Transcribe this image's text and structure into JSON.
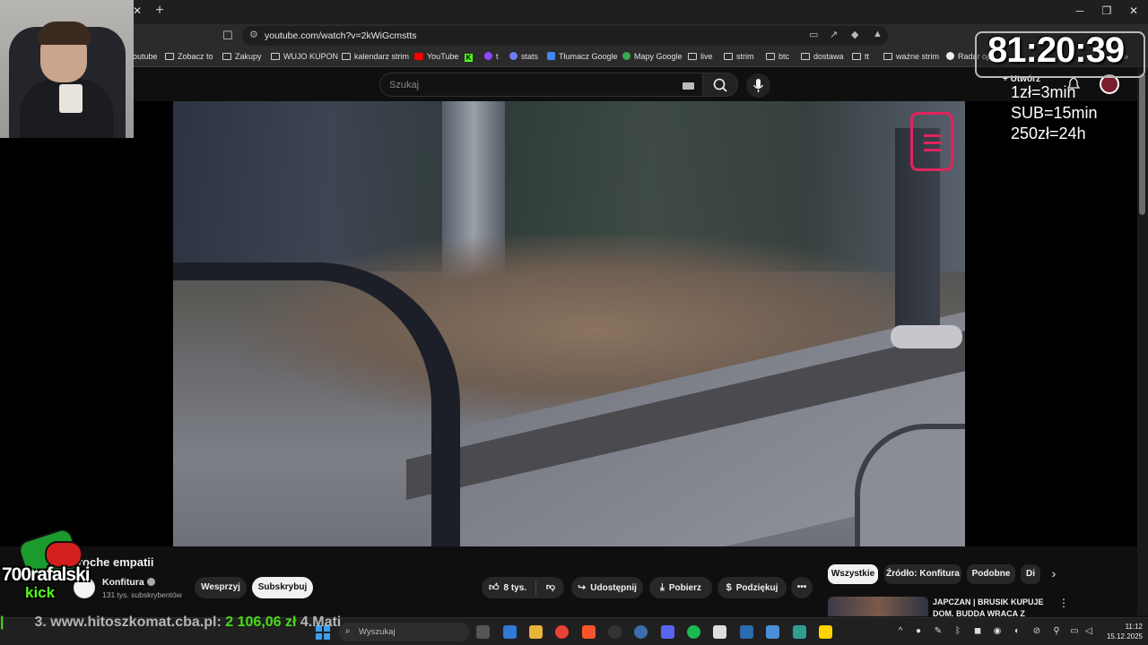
{
  "browser": {
    "url": "youtube.com/watch?v=2kWiGcmstts",
    "bookmarks": [
      "outube",
      "Zobacz to",
      "Zakupy",
      "WUJO KUPON",
      "kalendarz strim",
      "YouTube",
      "t",
      "stats",
      "Tłumacz Google",
      "Mapy Google",
      "live",
      "strim",
      "btc",
      "dostawa",
      "tt",
      "ważne strim",
      "Radar opa"
    ]
  },
  "youtube_header": {
    "search_placeholder": "Szukaj",
    "create_label": "Utwórz"
  },
  "video": {
    "title": "roche empatii",
    "channel": "Konfitura",
    "subscribers": "131 tys. subskrybentów",
    "join_label": "Wesprzyj",
    "subscribe_label": "Subskrybuj",
    "likes": "8 tys.",
    "share_label": "Udostępnij",
    "download_label": "Pobierz",
    "thanks_label": "Podziękuj"
  },
  "chips": [
    "Wszystkie",
    "Źródło: Konfitura",
    "Podobne",
    "Di"
  ],
  "recommendation": {
    "title": "JAPCZAN | BRUSIK KUPUJE DOM, BUDDA WRACA Z"
  },
  "stream_overlay": {
    "timer": "81:20:39",
    "rates": [
      "1zł=3min",
      "SUB=15min",
      "250zł=24h"
    ],
    "streamer_name": "700rafalski",
    "platform": "kick",
    "ticker": {
      "text1": "3. www.hitoszkomat.cba.pl:",
      "amount": "2 106,06 zł",
      "text2": "4.Mati"
    }
  },
  "taskbar": {
    "search_placeholder": "Wyszukaj",
    "time": "11:12",
    "date": "15.12.2025"
  },
  "colors": {
    "kick_green": "#53fc18",
    "youtube_red": "#ff0000",
    "background": "#0f0f0f"
  }
}
